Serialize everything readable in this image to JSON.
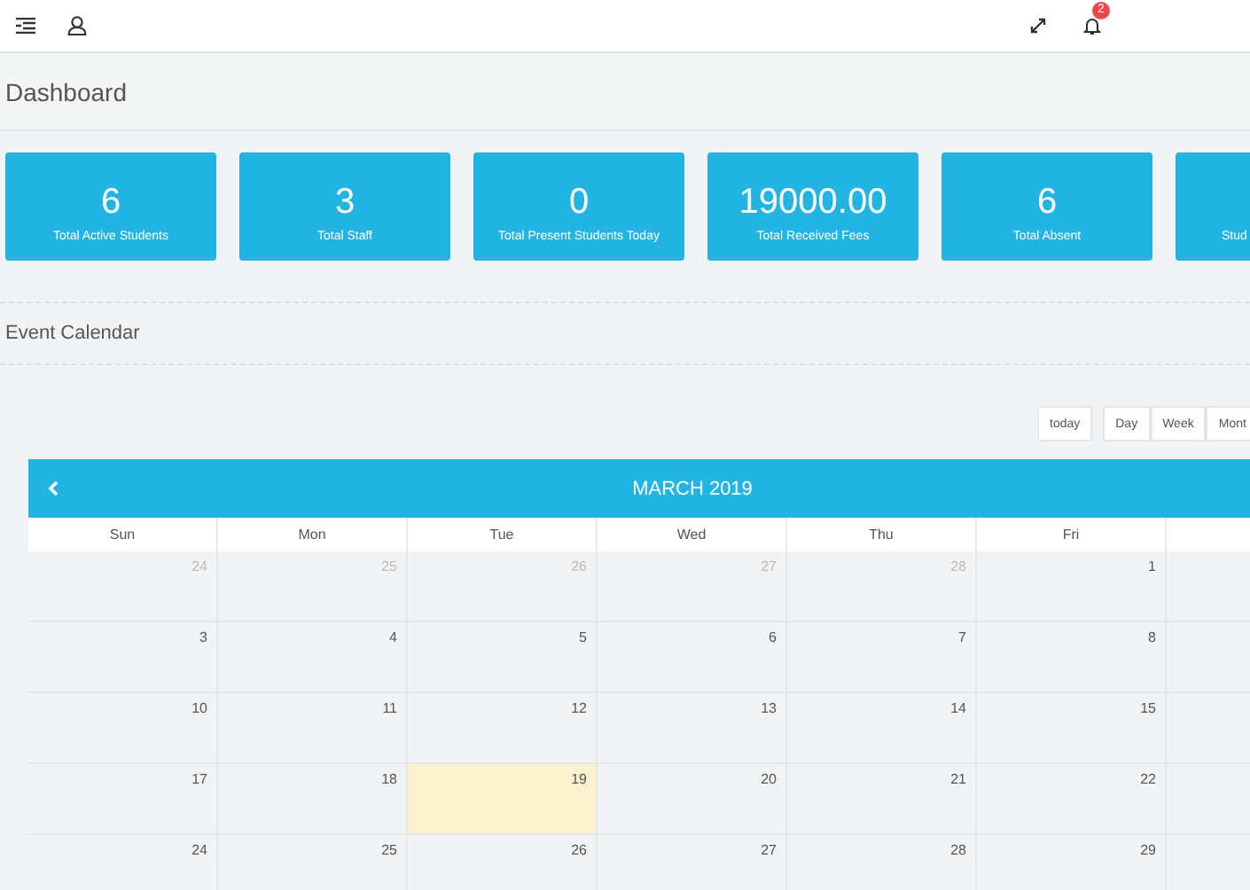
{
  "topbar": {
    "notification_count": "2"
  },
  "page_title": "Dashboard",
  "stats": [
    {
      "value": "6",
      "label": "Total Active Students"
    },
    {
      "value": "3",
      "label": "Total Staff"
    },
    {
      "value": "0",
      "label": "Total Present Students Today"
    },
    {
      "value": "19000.00",
      "label": "Total Received Fees"
    },
    {
      "value": "6",
      "label": "Total Absent"
    },
    {
      "label": "Stud"
    }
  ],
  "section_title": "Event Calendar",
  "calendar": {
    "today_button": "today",
    "views": [
      {
        "label": "Day",
        "selected": false
      },
      {
        "label": "Week",
        "selected": false
      },
      {
        "label": "Mont",
        "selected": false
      }
    ],
    "title": "MARCH 2019",
    "weekdays": [
      "Sun",
      "Mon",
      "Tue",
      "Wed",
      "Thu",
      "Fri"
    ],
    "weeks": [
      [
        {
          "day": "24",
          "other_month": true,
          "today": false
        },
        {
          "day": "25",
          "other_month": true,
          "today": false
        },
        {
          "day": "26",
          "other_month": true,
          "today": false
        },
        {
          "day": "27",
          "other_month": true,
          "today": false
        },
        {
          "day": "28",
          "other_month": true,
          "today": false
        },
        {
          "day": "1",
          "other_month": false,
          "today": false
        }
      ],
      [
        {
          "day": "3",
          "other_month": false,
          "today": false
        },
        {
          "day": "4",
          "other_month": false,
          "today": false
        },
        {
          "day": "5",
          "other_month": false,
          "today": false
        },
        {
          "day": "6",
          "other_month": false,
          "today": false
        },
        {
          "day": "7",
          "other_month": false,
          "today": false
        },
        {
          "day": "8",
          "other_month": false,
          "today": false
        }
      ],
      [
        {
          "day": "10",
          "other_month": false,
          "today": false
        },
        {
          "day": "11",
          "other_month": false,
          "today": false
        },
        {
          "day": "12",
          "other_month": false,
          "today": false
        },
        {
          "day": "13",
          "other_month": false,
          "today": false
        },
        {
          "day": "14",
          "other_month": false,
          "today": false
        },
        {
          "day": "15",
          "other_month": false,
          "today": false
        }
      ],
      [
        {
          "day": "17",
          "other_month": false,
          "today": false
        },
        {
          "day": "18",
          "other_month": false,
          "today": false
        },
        {
          "day": "19",
          "other_month": false,
          "today": true
        },
        {
          "day": "20",
          "other_month": false,
          "today": false
        },
        {
          "day": "21",
          "other_month": false,
          "today": false
        },
        {
          "day": "22",
          "other_month": false,
          "today": false
        }
      ],
      [
        {
          "day": "24",
          "other_month": false,
          "today": false
        },
        {
          "day": "25",
          "other_month": false,
          "today": false
        },
        {
          "day": "26",
          "other_month": false,
          "today": false
        },
        {
          "day": "27",
          "other_month": false,
          "today": false
        },
        {
          "day": "28",
          "other_month": false,
          "today": false
        },
        {
          "day": "29",
          "other_month": false,
          "today": false
        }
      ]
    ]
  }
}
